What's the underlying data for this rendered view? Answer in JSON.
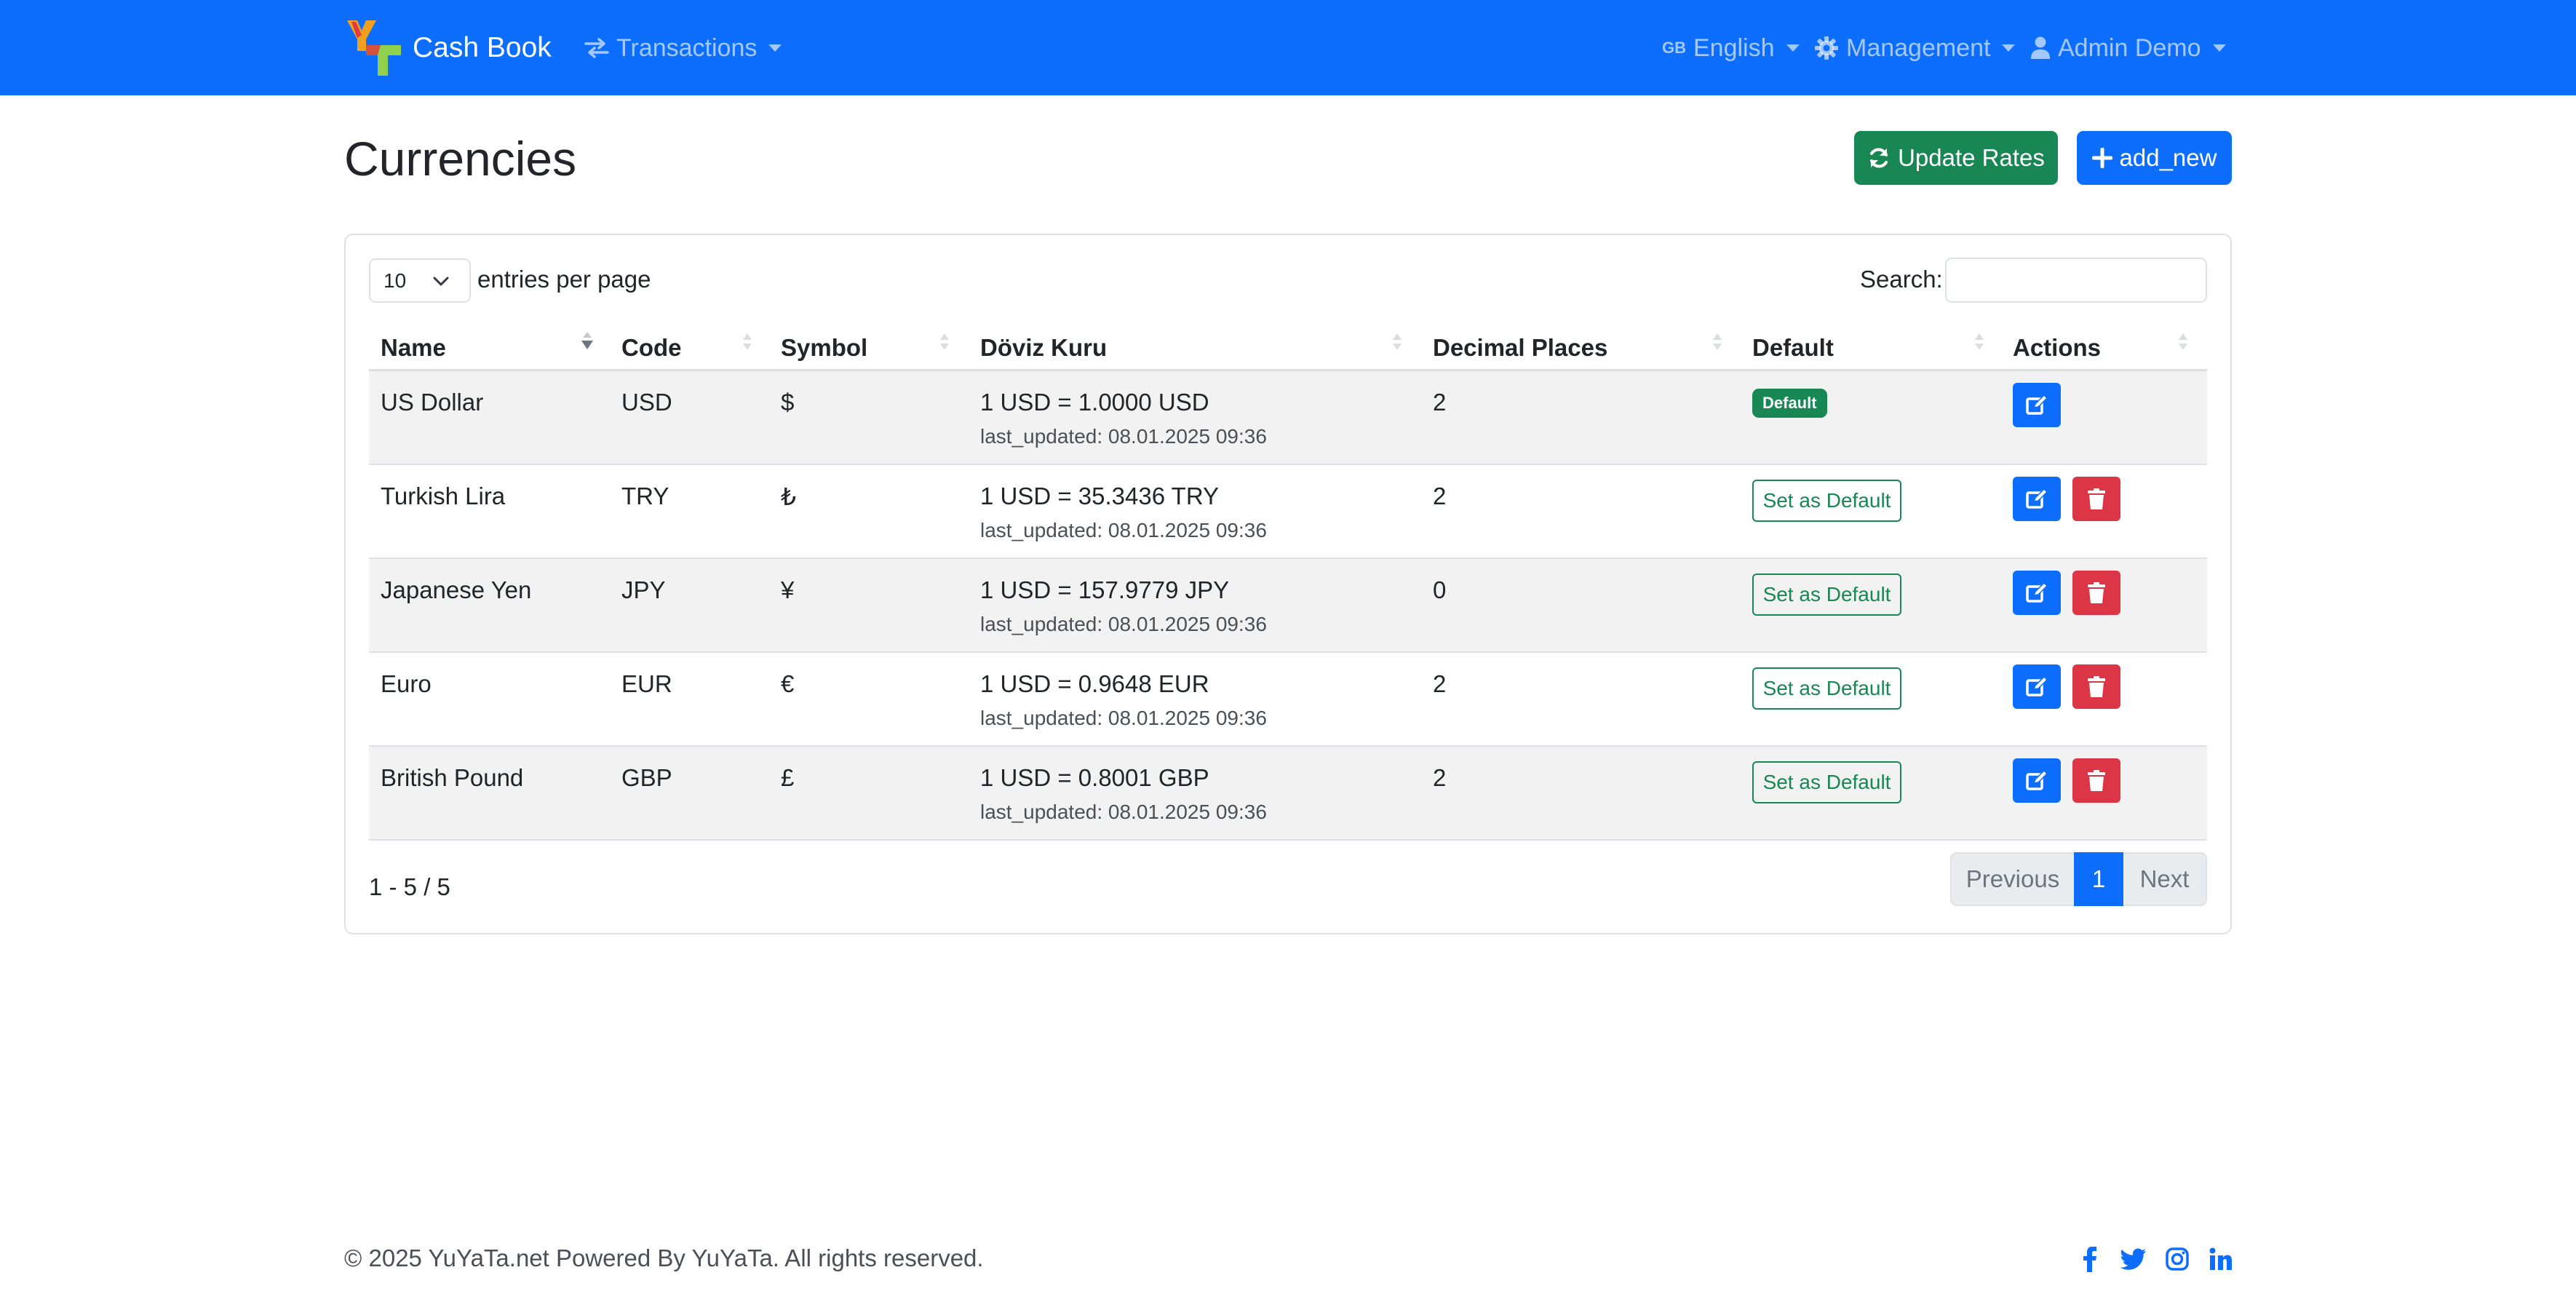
{
  "navbar": {
    "brand_title": "Cash Book",
    "transactions_label": "Transactions",
    "language_flag": "GB",
    "language_label": "English",
    "management_label": "Management",
    "user_label": "Admin Demo",
    "colors": {
      "primary": "#0d6efd"
    }
  },
  "header": {
    "title": "Currencies",
    "update_rates_label": "Update Rates",
    "add_new_label": "add_new"
  },
  "table_controls": {
    "entries_value": "10",
    "entries_label": "entries per page",
    "search_label": "Search:",
    "search_value": ""
  },
  "table": {
    "columns": [
      "Name",
      "Code",
      "Symbol",
      "Döviz Kuru",
      "Decimal Places",
      "Default",
      "Actions"
    ],
    "rows": [
      {
        "name": "US Dollar",
        "code": "USD",
        "symbol": "$",
        "rate": "1 USD = 1.0000 USD",
        "updated": "last_updated: 08.01.2025 09:36",
        "decimals": "2",
        "default": "Default",
        "is_default": true
      },
      {
        "name": "Turkish Lira",
        "code": "TRY",
        "symbol": "₺",
        "rate": "1 USD = 35.3436 TRY",
        "updated": "last_updated: 08.01.2025 09:36",
        "decimals": "2",
        "default": "Set as Default",
        "is_default": false
      },
      {
        "name": "Japanese Yen",
        "code": "JPY",
        "symbol": "¥",
        "rate": "1 USD = 157.9779 JPY",
        "updated": "last_updated: 08.01.2025 09:36",
        "decimals": "0",
        "default": "Set as Default",
        "is_default": false
      },
      {
        "name": "Euro",
        "code": "EUR",
        "symbol": "€",
        "rate": "1 USD = 0.9648 EUR",
        "updated": "last_updated: 08.01.2025 09:36",
        "decimals": "2",
        "default": "Set as Default",
        "is_default": false
      },
      {
        "name": "British Pound",
        "code": "GBP",
        "symbol": "£",
        "rate": "1 USD = 0.8001 GBP",
        "updated": "last_updated: 08.01.2025 09:36",
        "decimals": "2",
        "default": "Set as Default",
        "is_default": false
      }
    ]
  },
  "pagination": {
    "info": "1 - 5 / 5",
    "previous_label": "Previous",
    "current_page": "1",
    "next_label": "Next"
  },
  "footer": {
    "copyright": "© 2025 YuYaTa.net Powered By YuYaTa. All rights reserved.",
    "social_icons": [
      "facebook-icon",
      "twitter-icon",
      "instagram-icon",
      "linkedin-icon"
    ]
  }
}
